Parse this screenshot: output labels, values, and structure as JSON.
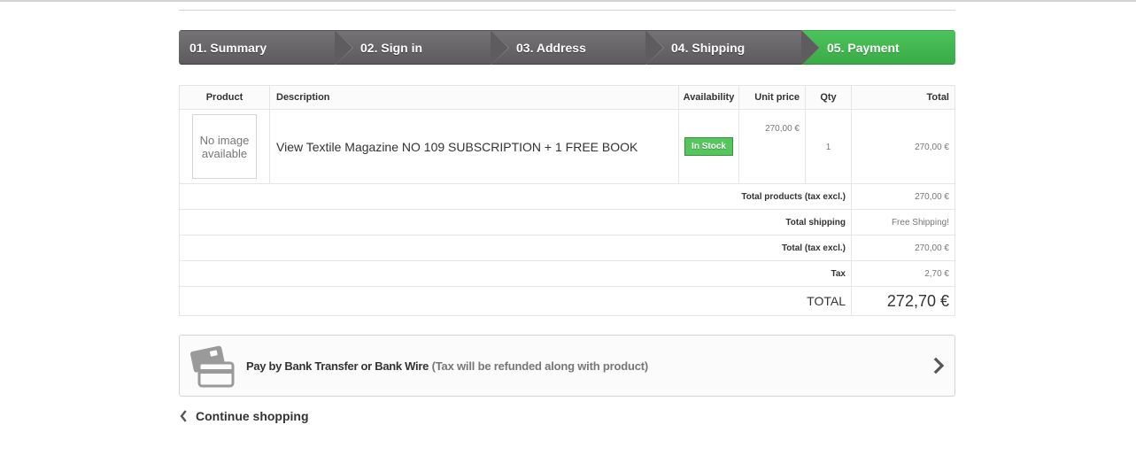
{
  "steps": [
    {
      "label": "01. Summary"
    },
    {
      "label": "02. Sign in"
    },
    {
      "label": "03. Address"
    },
    {
      "label": "04. Shipping"
    },
    {
      "label": "05. Payment"
    }
  ],
  "table": {
    "headers": {
      "product": "Product",
      "description": "Description",
      "availability": "Availability",
      "unit_price": "Unit price",
      "qty": "Qty",
      "total": "Total"
    },
    "item": {
      "image_line1": "No image",
      "image_line2": "available",
      "description": "View Textile Magazine NO 109 SUBSCRIPTION + 1 FREE BOOK",
      "availability": "In Stock",
      "unit_price": "270,00 €",
      "qty": "1",
      "total": "270,00 €"
    },
    "summary": {
      "total_products_label": "Total products (tax excl.)",
      "total_products_value": "270,00 €",
      "total_shipping_label": "Total shipping",
      "total_shipping_value": "Free Shipping!",
      "total_tax_excl_label": "Total (tax excl.)",
      "total_tax_excl_value": "270,00 €",
      "tax_label": "Tax",
      "tax_value": "2,70 €",
      "grand_total_label": "TOTAL",
      "grand_total_value": "272,70 €"
    }
  },
  "payment": {
    "method": "Pay by Bank Transfer or Bank Wire",
    "note": "(Tax will be refunded along with product)",
    "icon": "credit-card-icon"
  },
  "continue_label": "Continue shopping",
  "colors": {
    "step_default": "#666466",
    "step_active": "#46bb53",
    "in_stock": "#55c65e"
  }
}
